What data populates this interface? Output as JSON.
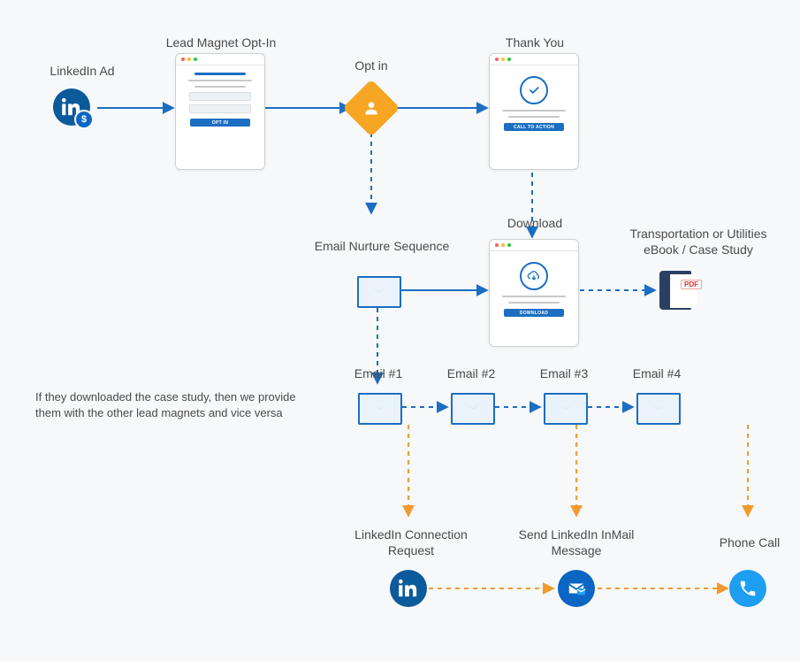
{
  "labels": {
    "linkedin_ad": "LinkedIn Ad",
    "lead_magnet": "Lead Magnet Opt-In",
    "opt_in": "Opt in",
    "thank_you": "Thank You",
    "download": "Download",
    "email_nurture": "Email Nurture Sequence",
    "ebook": "Transportation or Utilities eBook / Case Study",
    "email1": "Email #1",
    "email2": "Email #2",
    "email3": "Email #3",
    "email4": "Email #4",
    "li_connect": "LinkedIn Connection Request",
    "li_inmail": "Send LinkedIn InMail Message",
    "phone_call": "Phone Call"
  },
  "buttons": {
    "opt_in": "OPT IN",
    "cta": "CALL TO ACTION",
    "download": "DOWNLOAD"
  },
  "note": "If they downloaded the case study, then we provide them with the other lead magnets and vice versa",
  "book_tag": "PDF",
  "colors": {
    "blue": "#1b6ec2",
    "orange": "#f6a623",
    "dash_orange": "#f29a2e"
  },
  "nodes": [
    {
      "id": "linkedin_ad",
      "type": "linkedin-ad-icon"
    },
    {
      "id": "lead_magnet",
      "type": "browser-optin"
    },
    {
      "id": "opt_in",
      "type": "decision-diamond"
    },
    {
      "id": "thank_you",
      "type": "browser-thankyou"
    },
    {
      "id": "download_page",
      "type": "browser-download"
    },
    {
      "id": "nurture_email",
      "type": "envelope"
    },
    {
      "id": "ebook",
      "type": "book-pdf"
    },
    {
      "id": "email1",
      "type": "envelope"
    },
    {
      "id": "email2",
      "type": "envelope"
    },
    {
      "id": "email3",
      "type": "envelope"
    },
    {
      "id": "email4",
      "type": "envelope"
    },
    {
      "id": "li_connect",
      "type": "linkedin-icon"
    },
    {
      "id": "li_inmail",
      "type": "inmail-icon"
    },
    {
      "id": "phone_call",
      "type": "phone-icon"
    }
  ],
  "edges": [
    {
      "from": "linkedin_ad",
      "to": "lead_magnet",
      "style": "solid-blue"
    },
    {
      "from": "lead_magnet",
      "to": "opt_in",
      "style": "solid-blue"
    },
    {
      "from": "opt_in",
      "to": "thank_you",
      "style": "solid-blue"
    },
    {
      "from": "opt_in",
      "to": "nurture_email",
      "style": "dashed-blue"
    },
    {
      "from": "thank_you",
      "to": "download_page",
      "style": "dashed-blue",
      "label": "Download"
    },
    {
      "from": "nurture_email",
      "to": "download_page",
      "style": "solid-blue"
    },
    {
      "from": "download_page",
      "to": "ebook",
      "style": "dashed-blue"
    },
    {
      "from": "nurture_email",
      "to": "email1",
      "style": "dashed-blue"
    },
    {
      "from": "email1",
      "to": "email2",
      "style": "dashed-blue"
    },
    {
      "from": "email2",
      "to": "email3",
      "style": "dashed-blue"
    },
    {
      "from": "email3",
      "to": "email4",
      "style": "dashed-blue"
    },
    {
      "from": "email1",
      "to": "li_connect",
      "style": "dashed-orange"
    },
    {
      "from": "email3",
      "to": "li_inmail",
      "style": "dashed-orange"
    },
    {
      "from": "email4",
      "to": "phone_call",
      "style": "dashed-orange"
    },
    {
      "from": "li_connect",
      "to": "li_inmail",
      "style": "dashed-orange"
    },
    {
      "from": "li_inmail",
      "to": "phone_call",
      "style": "dashed-orange"
    }
  ]
}
